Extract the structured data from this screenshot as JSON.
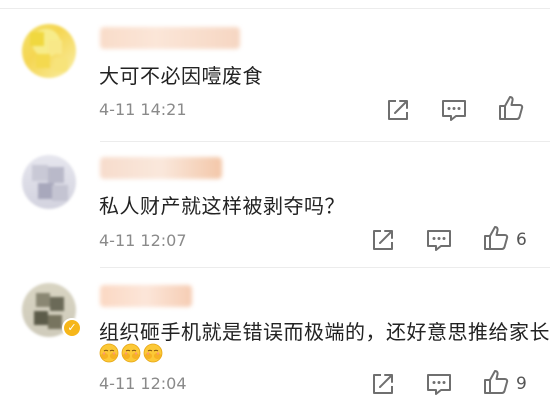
{
  "comments": [
    {
      "text": "大可不必因噎废食",
      "time": "4-11 14:21",
      "like_count": ""
    },
    {
      "text": "私人财产就这样被剥夺吗？",
      "time": "4-11 12:07",
      "like_count": "6"
    },
    {
      "text": "组织砸手机就是错误而极端的，还好意思推给家长",
      "time": "4-11 12:04",
      "like_count": "9",
      "emojis": [
        "cover-face-emoji",
        "cover-face-emoji",
        "cover-face-emoji"
      ]
    }
  ],
  "icons": {
    "share": "share-icon",
    "comment": "comment-icon",
    "like": "thumbs-up-icon",
    "verified": "verified-badge-icon"
  },
  "colors": {
    "text": "#222222",
    "meta": "#8a8a8a",
    "icon": "#6f6f6f",
    "badge": "#f6b61a"
  }
}
